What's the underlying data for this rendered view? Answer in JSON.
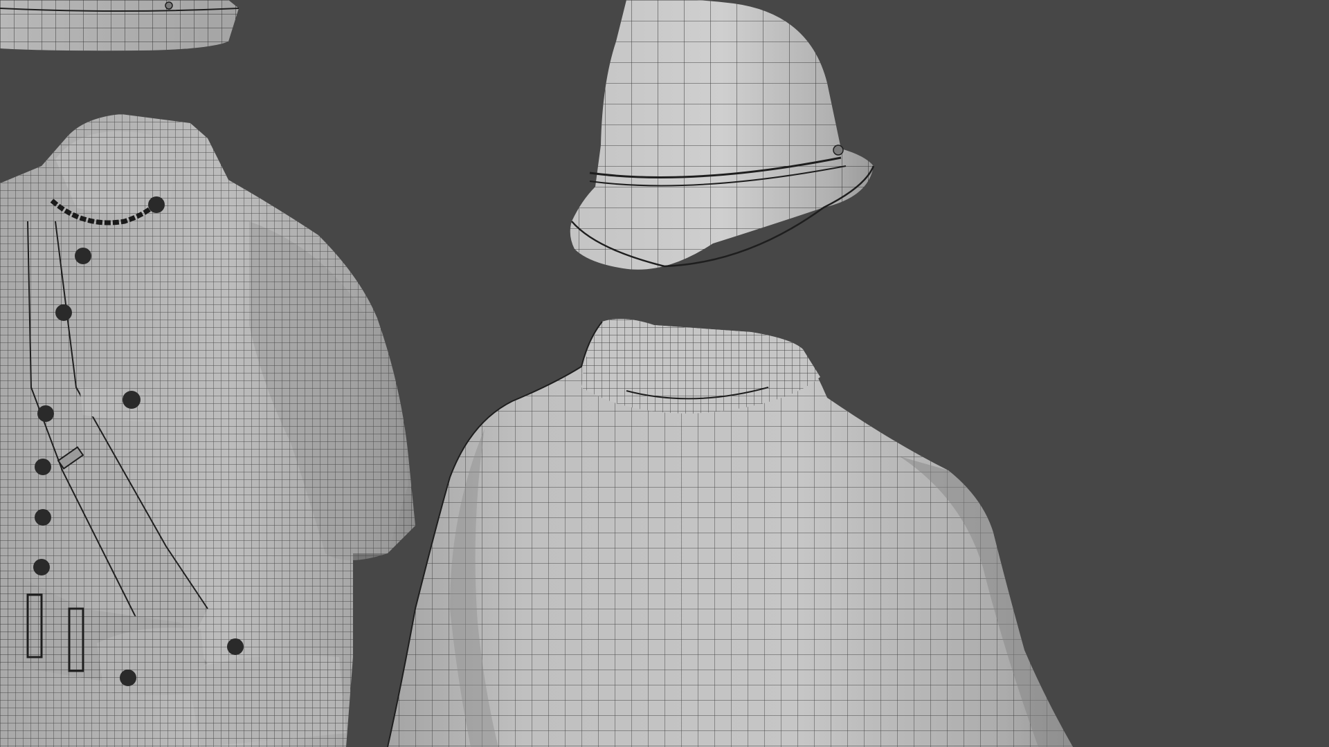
{
  "viewport": {
    "background_color": "#474747",
    "mesh_fill_color": "#b6b6b6",
    "mesh_shadow_color": "#8c8c8c",
    "mesh_highlight_color": "#d2d2d2",
    "wire_color": "#1e1e1e",
    "button_color": "#2a2a2a",
    "display_mode": "wireframe-on-shaded"
  },
  "objects": [
    {
      "name": "hat-partial"
    },
    {
      "name": "uniform-jacket-with-strap"
    },
    {
      "name": "helmet"
    },
    {
      "name": "cape"
    }
  ]
}
